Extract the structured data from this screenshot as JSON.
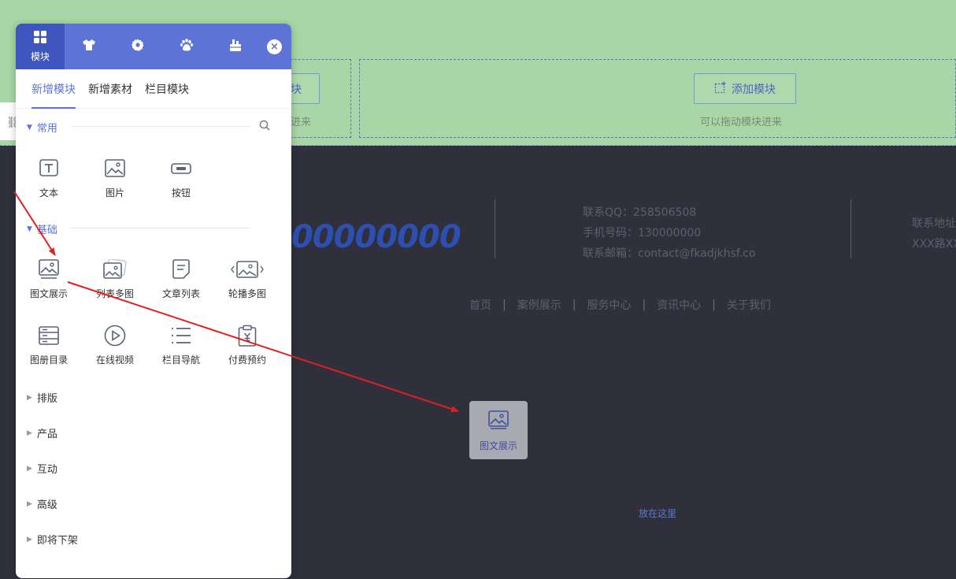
{
  "canvas": {
    "drop_zone_left": {
      "button_label": "块",
      "hint": "进来"
    },
    "drop_zone_right": {
      "button_label": "添加模块",
      "hint": "可以拖动模块进来"
    },
    "phone_number": "00000000",
    "contacts": {
      "qq": "联系QQ：258506508",
      "phone": "手机号码：130000000",
      "email": "联系邮箱：contact@fkadjkhsf.co",
      "address_label": "联系地址",
      "address": "XXX路XX"
    },
    "footer_nav": {
      "items": [
        "首页",
        "案例展示",
        "服务中心",
        "资讯中心",
        "关于我们"
      ],
      "separator": "|"
    },
    "drag_ghost_label": "图文展示",
    "drop_here": "放在这里"
  },
  "panel": {
    "header_tabs": [
      {
        "label": "模块",
        "icon": "grid-icon",
        "active": true
      },
      {
        "label": "",
        "icon": "shirt-icon"
      },
      {
        "label": "",
        "icon": "gear-icon"
      },
      {
        "label": "",
        "icon": "paw-icon"
      },
      {
        "label": "",
        "icon": "toolbox-icon"
      }
    ],
    "close": "×",
    "sub_tabs": [
      {
        "label": "新增模块",
        "active": true
      },
      {
        "label": "新增素材"
      },
      {
        "label": "栏目模块"
      }
    ],
    "sections": {
      "common": {
        "title": "常用",
        "items": [
          {
            "label": "文本",
            "icon": "text-icon"
          },
          {
            "label": "图片",
            "icon": "image-icon"
          },
          {
            "label": "按钮",
            "icon": "button-icon"
          }
        ]
      },
      "basic": {
        "title": "基础",
        "items": [
          {
            "label": "图文展示",
            "icon": "image-text-icon"
          },
          {
            "label": "列表多图",
            "icon": "multi-image-icon"
          },
          {
            "label": "文章列表",
            "icon": "article-icon"
          },
          {
            "label": "轮播多图",
            "icon": "carousel-icon"
          },
          {
            "label": "图册目录",
            "icon": "album-icon"
          },
          {
            "label": "在线视频",
            "icon": "video-icon"
          },
          {
            "label": "栏目导航",
            "icon": "list-nav-icon"
          },
          {
            "label": "付费预约",
            "icon": "paid-booking-icon"
          }
        ]
      },
      "collapsed": [
        "排版",
        "产品",
        "互动",
        "高级",
        "即将下架"
      ]
    }
  },
  "colors": {
    "accent": "#5d73d6",
    "green_area": "#a8d6a6",
    "dark_bg": "#2f303c",
    "arrow": "#e02020"
  }
}
